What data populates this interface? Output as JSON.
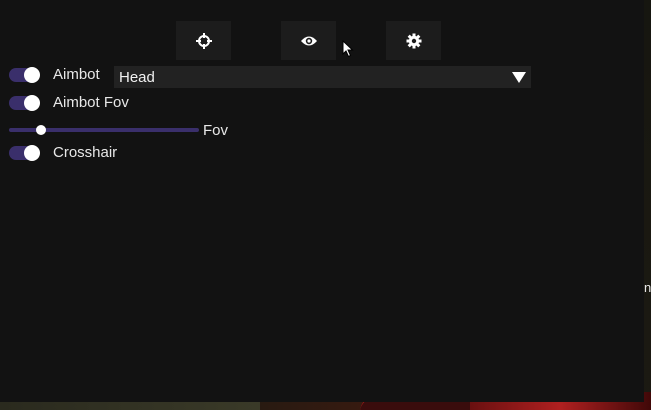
{
  "menu": {
    "tabs": [
      {
        "id": "aim",
        "icon": "crosshair-target-icon"
      },
      {
        "id": "visuals",
        "icon": "eye-icon"
      },
      {
        "id": "settings",
        "icon": "gear-icon"
      }
    ],
    "aimbot": {
      "label": "Aimbot",
      "enabled": true
    },
    "aimbot_target": {
      "selected": "Head"
    },
    "aimbot_fov": {
      "label": "Aimbot Fov",
      "enabled": true
    },
    "fov_slider": {
      "label": "Fov",
      "value_fraction": 0.15
    },
    "crosshair": {
      "label": "Crosshair",
      "enabled": true
    }
  },
  "game": {
    "edge_text": "n"
  },
  "colors": {
    "panel": "#121212",
    "tab_bg": "#1c1c1c",
    "accent": "#3a2f6b",
    "text": "#e8e8e8"
  }
}
